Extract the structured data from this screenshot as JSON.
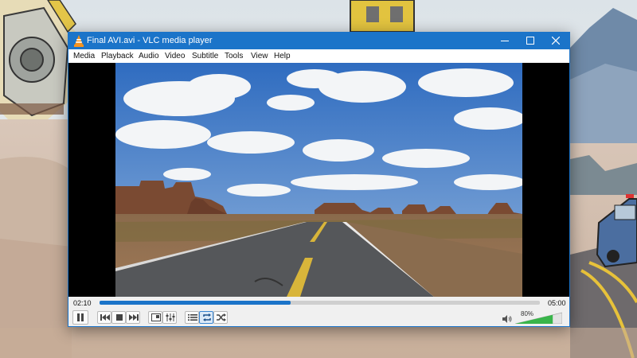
{
  "window": {
    "title": "Final AVI.avi - VLC media player",
    "accent_color": "#1b74c9",
    "controls": [
      "minimize-icon",
      "maximize-icon",
      "close-icon"
    ]
  },
  "menu": {
    "items": [
      "Media",
      "Playback",
      "Audio",
      "Video",
      "Subtitle",
      "Tools",
      "View",
      "Help"
    ]
  },
  "video": {
    "content": "desert highway with mesa buttes under a cloudy blue sky"
  },
  "playback": {
    "elapsed": "02:10",
    "total": "05:00",
    "progress_fraction": 0.434
  },
  "buttons": {
    "icons": [
      "pause-icon",
      "previous-icon",
      "stop-icon",
      "next-icon",
      "fullscreen-icon",
      "extended-settings-icon",
      "playlist-icon",
      "loop-icon",
      "random-icon"
    ],
    "loop_active": true
  },
  "volume": {
    "label": "80%",
    "level_fraction": 0.8,
    "icon": "speaker-icon"
  }
}
